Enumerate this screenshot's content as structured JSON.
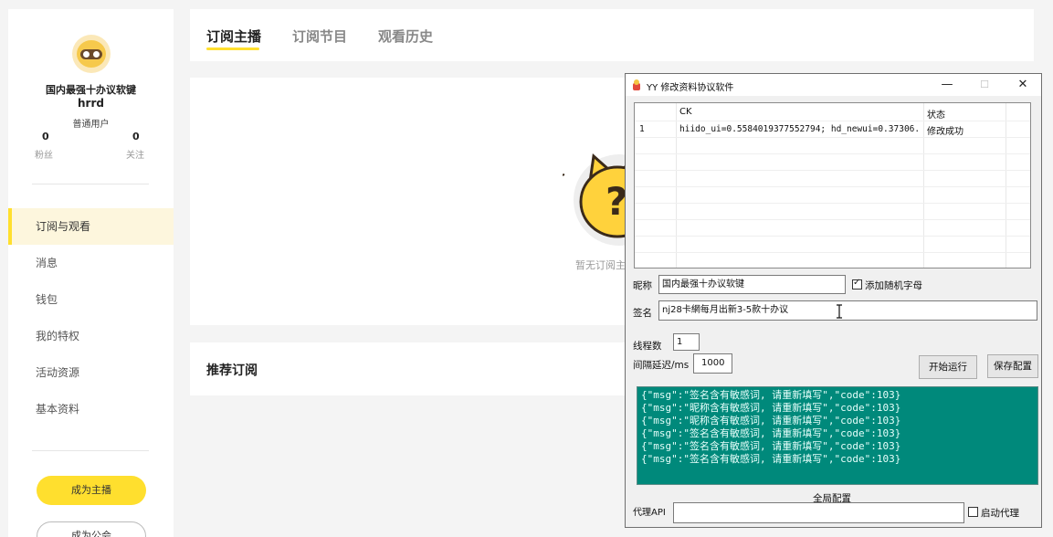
{
  "profile": {
    "name": "国内最强十办议软键",
    "sub_name": "hrrd",
    "level": "普通用户",
    "fans_count": "0",
    "fans_label": "粉丝",
    "follow_count": "0",
    "follow_label": "关注"
  },
  "sidebar": {
    "items": [
      {
        "label": "订阅与观看",
        "active": true
      },
      {
        "label": "消息"
      },
      {
        "label": "钱包"
      },
      {
        "label": "我的特权"
      },
      {
        "label": "活动资源"
      },
      {
        "label": "基本资料"
      }
    ],
    "become_anchor": "成为主播",
    "become_guild": "成为公会"
  },
  "tabs": [
    {
      "label": "订阅主播",
      "active": true
    },
    {
      "label": "订阅节目"
    },
    {
      "label": "观看历史"
    }
  ],
  "empty_state": {
    "text": "暂无订阅主"
  },
  "recommend": {
    "title": "推荐订阅"
  },
  "dialog": {
    "title": "YY 修改资料协议软件",
    "controls": {
      "minimize": "—",
      "maximize": "☐",
      "close": "✕"
    },
    "table": {
      "headers": [
        "",
        "CK",
        "状态"
      ],
      "rows": [
        [
          "1",
          "hiido_ui=0.5584019377552794; hd_newui=0.37306...",
          "修改成功"
        ]
      ]
    },
    "nickname_label": "昵称",
    "nickname_value": "国内最强十办议软键",
    "random_letters_label": "添加随机字母",
    "random_letters_checked": true,
    "signature_label": "签名",
    "signature_value": "nj28卡網每月出新3-5款十办议",
    "threads_label": "线程数",
    "threads_value": "1",
    "interval_label": "间隔延迟/ms",
    "interval_value": "1000",
    "start_button": "开始运行",
    "save_button": "保存配置",
    "log_lines": [
      "{\"msg\":\"签名含有敏感词, 请重新填写\",\"code\":103}",
      "{\"msg\":\"昵称含有敏感词, 请重新填写\",\"code\":103}",
      "{\"msg\":\"昵称含有敏感词, 请重新填写\",\"code\":103}",
      "{\"msg\":\"签名含有敏感词, 请重新填写\",\"code\":103}",
      "{\"msg\":\"签名含有敏感词, 请重新填写\",\"code\":103}",
      "{\"msg\":\"签名含有敏感词, 请重新填写\",\"code\":103}"
    ],
    "global_config_label": "全局配置",
    "proxy_api_label": "代理API",
    "proxy_api_value": "",
    "enable_proxy_label": "启动代理",
    "enable_proxy_checked": false
  }
}
